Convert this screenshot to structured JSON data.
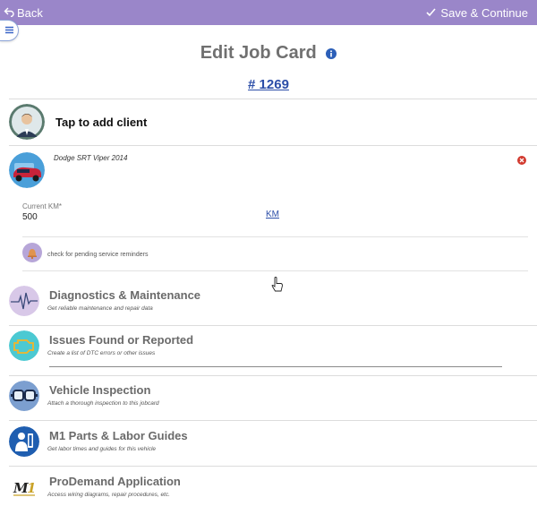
{
  "topbar": {
    "back_label": "Back",
    "save_label": "Save & Continue",
    "color": "#9a86c9"
  },
  "page": {
    "title": "Edit Job Card",
    "job_number": "# 1269"
  },
  "client": {
    "label": "Tap to add client"
  },
  "vehicle": {
    "name": "Dodge SRT Viper 2014",
    "km_label": "Current KM*",
    "km_value": "500",
    "km_unit": "KM",
    "reminder_label": "check for pending service reminders"
  },
  "services": [
    {
      "title": "Diagnostics & Maintenance",
      "subtitle": "Get reliable maintenance and repair data",
      "icon": "heartbeat-icon"
    },
    {
      "title": "Issues Found or Reported",
      "subtitle": "Create a list of DTC errors or other issues",
      "icon": "engine-warning-icon"
    },
    {
      "title": "Vehicle Inspection",
      "subtitle": "Attach a thorough inspection to this jobcard",
      "icon": "goggles-icon"
    },
    {
      "title": "M1 Parts & Labor Guides",
      "subtitle": "Get labor times and guides for this vehicle",
      "icon": "mechanic-icon"
    },
    {
      "title": "ProDemand Application",
      "subtitle": "Access wiring diagrams, repair procedures, etc.",
      "icon": "m1-logo-icon"
    }
  ],
  "colors": {
    "accent": "#9a86c9",
    "link": "#2c4ea8",
    "remove": "#d23a2f"
  }
}
